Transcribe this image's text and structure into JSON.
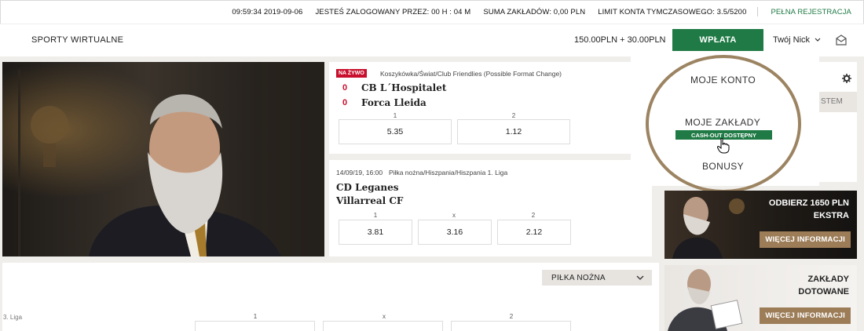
{
  "topbar": {
    "time": "09:59:34 2019-09-06",
    "logged_in": "JESTEŚ ZALOGOWANY PRZEZ: 00 H : 04 M",
    "bets_sum": "SUMA ZAKŁADÓW: 0,00 PLN",
    "limit": "LIMIT KONTA TYMCZASOWEGO: 3.5/5200",
    "register": "PEŁNA REJESTRACJA"
  },
  "header": {
    "brand": "SPORTY WIRTUALNE",
    "balance": "150.00PLN + 30.00PLN",
    "deposit": "WPŁATA",
    "nick": "Twój Nick"
  },
  "live_event": {
    "badge": "NA ŻYWO",
    "category": "Koszykówka/Świat/Club Friendlies (Possible Format Change)",
    "team1": "CB L´Hospitalet",
    "team2": "Forca Lleida",
    "score1": "0",
    "score2": "0",
    "outcomes": [
      {
        "label": "1",
        "odd": "5.35"
      },
      {
        "label": "2",
        "odd": "1.12"
      }
    ]
  },
  "upcoming_event": {
    "datetime": "14/09/19, 16:00",
    "category": "Piłka nożna/Hiszpania/Hiszpania 1. Liga",
    "team1": "CD Leganes",
    "team2": "Villarreal CF",
    "outcomes": [
      {
        "label": "1",
        "odd": "3.81"
      },
      {
        "label": "x",
        "odd": "3.16"
      },
      {
        "label": "2",
        "odd": "2.12"
      }
    ]
  },
  "account_menu": {
    "my_account": "MOJE KONTO",
    "my_bets": "MOJE ZAKŁADY",
    "cashout": "CASH-OUT DOSTĘPNY",
    "bonuses": "BONUSY",
    "side_tab": "STEM"
  },
  "promos": [
    {
      "title_line1": "ODBIERZ 1650 PLN",
      "title_line2": "EKSTRA",
      "button": "WIĘCEJ INFORMACJI"
    },
    {
      "title_line1": "ZAKŁADY",
      "title_line2": "DOTOWANE",
      "button": "WIĘCEJ INFORMACJI"
    }
  ],
  "sport_select": {
    "value": "PIŁKA NOŻNA"
  },
  "list": {
    "league": "3. Liga",
    "columns": [
      "1",
      "x",
      "2"
    ]
  },
  "colors": {
    "accent": "#1f7a45",
    "live": "#c8102e",
    "gold": "#9c8462"
  }
}
